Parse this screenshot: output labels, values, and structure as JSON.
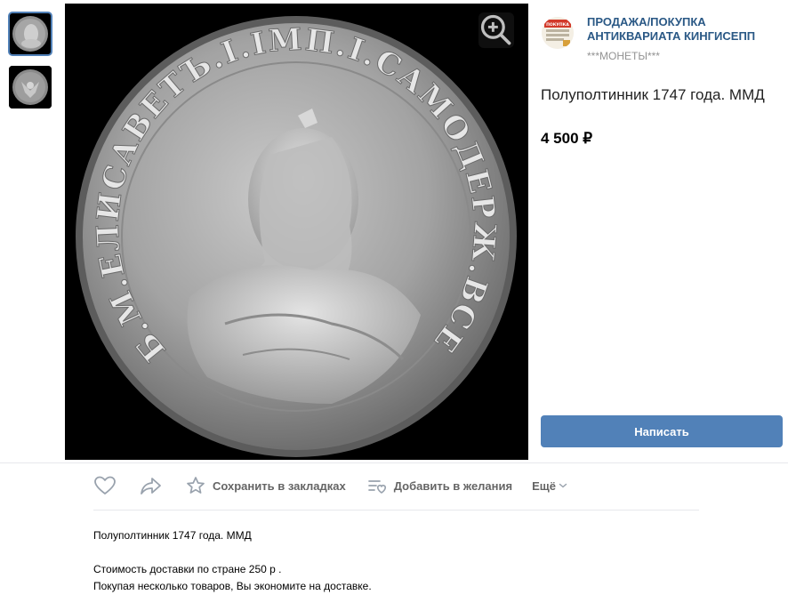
{
  "seller": {
    "name": "ПРОДАЖА/ПОКУПКА АНТИКВАРИАТА КИНГИСЕПП",
    "subtitle": "***МОНЕТЫ***",
    "logo_text": "ПОКУПКА ПРОДАЖА"
  },
  "coin": {
    "obverse_legend": "Б.М.ЕЛИСАВЕТЪ.I.IМП.I.САМОДЕРЖ.ВСЕРОС."
  },
  "product": {
    "title": "Полуполтинник 1747 года. ММД",
    "price": "4 500 ₽"
  },
  "buttons": {
    "write": "Написать"
  },
  "actions": {
    "bookmark": "Сохранить в закладках",
    "wishlist": "Добавить в желания",
    "more": "Ещё"
  },
  "description": {
    "line1": "Полуполтинник 1747 года. ММД",
    "line2": "Стоимость доставки по стране 250 р .",
    "line3": "Покупая несколько товаров, Вы экономите на доставке."
  },
  "icons": {
    "zoom": "zoom-in-icon",
    "like": "heart-icon",
    "share": "share-arrow-icon",
    "bookmark": "star-icon",
    "wishlist": "gift-list-icon",
    "more": "chevron-down-icon"
  },
  "colors": {
    "accent": "#5181b8",
    "link": "#2a5885",
    "muted": "#939393",
    "action": "#656565",
    "icon": "#99a2ad"
  }
}
